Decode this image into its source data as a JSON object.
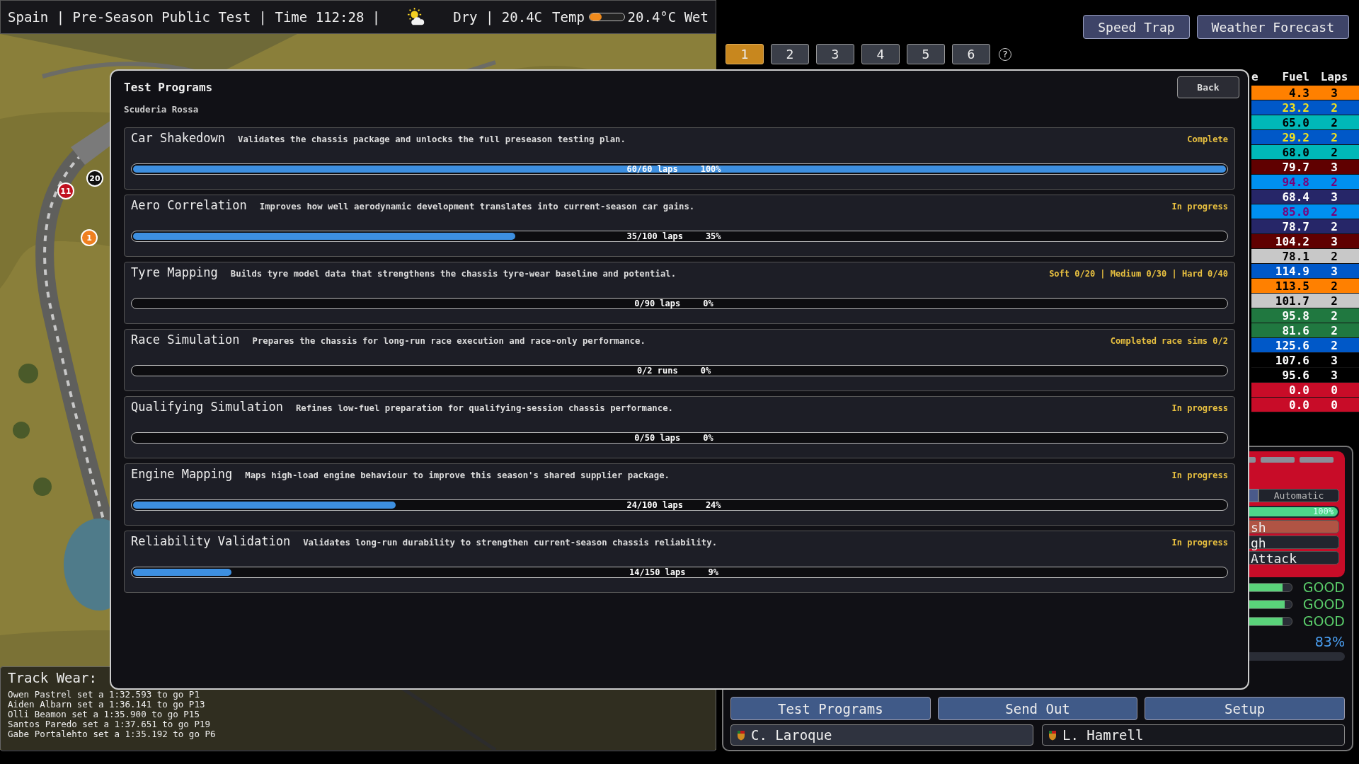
{
  "topbar": {
    "session": "Spain | Pre-Season Public Test | Time 112:28 |",
    "weather": "Dry | 20.4C",
    "temp_label": "Temp",
    "temp_slider": {
      "level": 0.35
    },
    "temp_reading": "20.4°C Wet"
  },
  "map_markers": [
    {
      "number": "20",
      "color": "#111111"
    },
    {
      "number": "11",
      "color": "#c01020"
    },
    {
      "number": "1",
      "color": "#f08020"
    }
  ],
  "track_wear": {
    "label": "Track Wear:",
    "log": [
      "Owen Pastrel set a 1:32.593 to go P1",
      "Aiden Albarn set a 1:36.141 to go P13",
      "Olli Beamon set a 1:35.900 to go P15",
      "Santos Paredo set a 1:37.651 to go P19",
      "Gabe Portalehto set a 1:35.192 to go P6"
    ]
  },
  "top_buttons": [
    "Speed Trap",
    "Weather Forecast"
  ],
  "tabs": [
    {
      "label": "1",
      "selected": true
    },
    {
      "label": "2",
      "selected": false
    },
    {
      "label": "3",
      "selected": false
    },
    {
      "label": "4",
      "selected": false
    },
    {
      "label": "5",
      "selected": false
    },
    {
      "label": "6",
      "selected": false
    }
  ],
  "help": "?",
  "timing": {
    "columns": [
      "e",
      "Fuel",
      "Laps"
    ],
    "rows": [
      {
        "fuel": "4.3",
        "laps": "3",
        "color": "#ff8000",
        "kind": "normal"
      },
      {
        "fuel": "23.2",
        "laps": "2",
        "color": "#0058c8",
        "kind": "marked"
      },
      {
        "fuel": "65.0",
        "laps": "2",
        "color": "#00b8b8",
        "kind": "normal"
      },
      {
        "fuel": "29.2",
        "laps": "2",
        "color": "#0058c8",
        "kind": "marked"
      },
      {
        "fuel": "68.0",
        "laps": "2",
        "color": "#00b8b8",
        "kind": "normal"
      },
      {
        "fuel": "79.7",
        "laps": "3",
        "color": "#600000",
        "kind": "normal"
      },
      {
        "fuel": "94.8",
        "laps": "2",
        "color": "#0090f0",
        "kind": "alt_marked"
      },
      {
        "fuel": "68.4",
        "laps": "3",
        "color": "#262668",
        "kind": "normal"
      },
      {
        "fuel": "85.0",
        "laps": "2",
        "color": "#0090f0",
        "kind": "alt_marked"
      },
      {
        "fuel": "78.7",
        "laps": "2",
        "color": "#262668",
        "kind": "normal"
      },
      {
        "fuel": "104.2",
        "laps": "3",
        "color": "#600000",
        "kind": "normal"
      },
      {
        "fuel": "78.1",
        "laps": "2",
        "color": "#c8c8c8",
        "kind": "normal"
      },
      {
        "fuel": "114.9",
        "laps": "3",
        "color": "#0058c8",
        "kind": "normal"
      },
      {
        "fuel": "113.5",
        "laps": "2",
        "color": "#ff8000",
        "kind": "normal"
      },
      {
        "fuel": "101.7",
        "laps": "2",
        "color": "#c8c8c8",
        "kind": "normal"
      },
      {
        "fuel": "95.8",
        "laps": "2",
        "color": "#207840",
        "kind": "normal"
      },
      {
        "fuel": "81.6",
        "laps": "2",
        "color": "#207840",
        "kind": "normal"
      },
      {
        "fuel": "125.6",
        "laps": "2",
        "color": "#0058c8",
        "kind": "normal"
      },
      {
        "fuel": "107.6",
        "laps": "3",
        "color": "#000000",
        "kind": "normal"
      },
      {
        "fuel": "95.6",
        "laps": "3",
        "color": "#000000",
        "kind": "normal"
      },
      {
        "fuel": "0.0",
        "laps": "0",
        "color": "#c80c28",
        "kind": "normal"
      },
      {
        "fuel": "0.0",
        "laps": "0",
        "color": "#c80c28",
        "kind": "normal"
      }
    ]
  },
  "car_panel": {
    "mode": "Automatic",
    "fuel": {
      "level": 1,
      "reading": "100%"
    },
    "options": [
      {
        "label": "sh",
        "selected": true
      },
      {
        "label": "gh",
        "selected": false
      },
      {
        "label": "Attack",
        "selected": false
      }
    ],
    "conditions": [
      {
        "level": 0.82,
        "status": "GOOD"
      },
      {
        "level": 0.86,
        "status": "GOOD"
      },
      {
        "level": 0.82,
        "status": "GOOD"
      }
    ],
    "overall": "83%"
  },
  "bottom_buttons": [
    "Test Programs",
    "Send Out",
    "Setup"
  ],
  "drivers": [
    {
      "name": "C. Laroque",
      "selected": true
    },
    {
      "name": "L. Hamrell",
      "selected": false
    }
  ],
  "modal": {
    "title": "Test Programs",
    "team": "Scuderia Rossa",
    "back": "Back",
    "programs": [
      {
        "name": "Car Shakedown",
        "description": "Validates the chassis package and unlocks the full preseason testing plan.",
        "status": "Complete",
        "level": 1,
        "progress": "60/60 laps",
        "percent": "100%"
      },
      {
        "name": "Aero Correlation",
        "description": "Improves how well aerodynamic development translates into current-season car gains.",
        "status": "In progress",
        "level": 0.35,
        "progress": "35/100 laps",
        "percent": "35%"
      },
      {
        "name": "Tyre Mapping",
        "description": "Builds tyre model data that strengthens the chassis tyre-wear baseline and potential.",
        "status": "Soft 0/20 | Medium 0/30 | Hard 0/40",
        "progress": "0/90 laps",
        "percent": "0%"
      },
      {
        "name": "Race Simulation",
        "description": "Prepares the chassis for long-run race execution and race-only performance.",
        "status": "Completed race sims 0/2",
        "progress": "0/2 runs",
        "percent": "0%"
      },
      {
        "name": "Qualifying Simulation",
        "description": "Refines low-fuel preparation for qualifying-session chassis performance.",
        "status": "In progress",
        "progress": "0/50 laps",
        "percent": "0%"
      },
      {
        "name": "Engine Mapping",
        "description": "Maps high-load engine behaviour to improve this season's shared supplier package.",
        "status": "In progress",
        "level": 0.24,
        "progress": "24/100 laps",
        "percent": "24%"
      },
      {
        "name": "Reliability Validation",
        "description": "Validates long-run durability to strengthen current-season chassis reliability.",
        "status": "In progress",
        "level": 0.09,
        "progress": "14/150 laps",
        "percent": "9%"
      }
    ]
  }
}
